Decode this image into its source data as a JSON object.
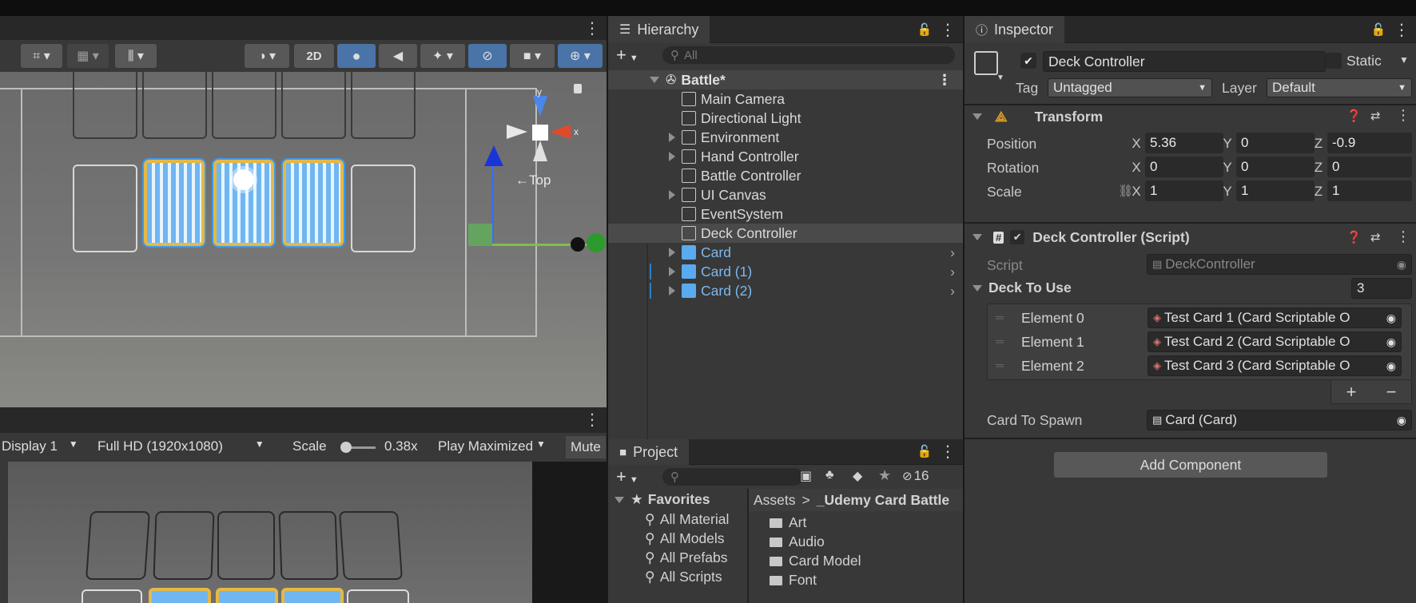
{
  "scene_toolbar": {
    "toggle_2d": "2D"
  },
  "gizmo": {
    "axis_y": "y",
    "axis_x": "x",
    "view_label": "←Top"
  },
  "game_toolbar": {
    "display": "Display 1",
    "resolution": "Full HD (1920x1080)",
    "scale_label": "Scale",
    "scale_value": "0.38x",
    "play_mode": "Play Maximized",
    "mute": "Mute"
  },
  "hierarchy": {
    "tab": "Hierarchy",
    "search_placeholder": "All",
    "scene": "Battle*",
    "items": [
      {
        "label": "Main Camera",
        "prefab": false,
        "expandable": false
      },
      {
        "label": "Directional Light",
        "prefab": false,
        "expandable": false
      },
      {
        "label": "Environment",
        "prefab": false,
        "expandable": true
      },
      {
        "label": "Hand Controller",
        "prefab": false,
        "expandable": true
      },
      {
        "label": "Battle Controller",
        "prefab": false,
        "expandable": false
      },
      {
        "label": "UI Canvas",
        "prefab": false,
        "expandable": true
      },
      {
        "label": "EventSystem",
        "prefab": false,
        "expandable": false
      },
      {
        "label": "Deck Controller",
        "prefab": false,
        "expandable": false,
        "selected": true
      },
      {
        "label": "Card",
        "prefab": true,
        "expandable": true
      },
      {
        "label": "Card (1)",
        "prefab": true,
        "expandable": true
      },
      {
        "label": "Card (2)",
        "prefab": true,
        "expandable": true
      }
    ]
  },
  "project": {
    "tab": "Project",
    "hidden_count": "16",
    "favorites_label": "Favorites",
    "favorites": [
      "All Material",
      "All Models",
      "All Prefabs",
      "All Scripts"
    ],
    "breadcrumb_root": "Assets",
    "breadcrumb_sep": ">",
    "breadcrumb_folder": "_Udemy Card Battle",
    "folders": [
      "Art",
      "Audio",
      "Card Model",
      "Font"
    ]
  },
  "inspector": {
    "tab": "Inspector",
    "object_name": "Deck Controller",
    "static_label": "Static",
    "tag_label": "Tag",
    "tag_value": "Untagged",
    "layer_label": "Layer",
    "layer_value": "Default",
    "transform": {
      "title": "Transform",
      "position_label": "Position",
      "rotation_label": "Rotation",
      "scale_label": "Scale",
      "axis_x": "X",
      "axis_y": "Y",
      "axis_z": "Z",
      "position": [
        "5.36",
        "0",
        "-0.9"
      ],
      "rotation": [
        "0",
        "0",
        "0"
      ],
      "scale": [
        "1",
        "1",
        "1"
      ]
    },
    "script_component": {
      "title": "Deck Controller (Script)",
      "script_label": "Script",
      "script_value": "DeckController",
      "deck_label": "Deck To Use",
      "deck_size": "3",
      "elements": [
        {
          "label": "Element 0",
          "value": "Test Card 1 (Card Scriptable O"
        },
        {
          "label": "Element 1",
          "value": "Test Card 2 (Card Scriptable O"
        },
        {
          "label": "Element 2",
          "value": "Test Card 3 (Card Scriptable O"
        }
      ],
      "add_symbol": "+",
      "remove_symbol": "−",
      "spawn_label": "Card To Spawn",
      "spawn_value": "Card (Card)"
    },
    "add_component": "Add Component"
  }
}
